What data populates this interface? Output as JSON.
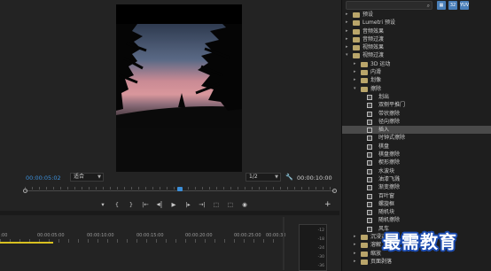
{
  "program_monitor": {
    "timecode_current": "00:00:05:02",
    "fit": "适合",
    "resolution": "1/2",
    "timecode_duration": "00:00:10:00",
    "playhead_progress": 0.5
  },
  "transport": {
    "buttons": [
      "mark-in",
      "mark-out",
      "go-to-in",
      "step-back",
      "play",
      "step-forward",
      "go-to-out",
      "lift",
      "extract",
      "export-frame",
      "compare"
    ],
    "glyphs": [
      "▾",
      "{",
      "}",
      "|←",
      "◂|",
      "▶",
      "|▸",
      "→|",
      "⬚",
      "⬚",
      "◉"
    ]
  },
  "timeline": {
    "ruler_labels": [
      "00:00",
      "00:00:05:00",
      "00:00:10:00",
      "00:00:15:00",
      "00:00:20:00",
      "00:00:25:00",
      "00:00:30"
    ],
    "vu_labels": [
      "-12",
      "-18",
      "-24",
      "-30",
      "-36"
    ]
  },
  "effects_panel": {
    "search_placeholder": "",
    "tree": [
      {
        "label": "预设",
        "level": 0,
        "type": "folder",
        "open": false
      },
      {
        "label": "Lumetri 预设",
        "level": 0,
        "type": "folder",
        "open": false
      },
      {
        "label": "音频效果",
        "level": 0,
        "type": "folder",
        "open": false
      },
      {
        "label": "音频过渡",
        "level": 0,
        "type": "folder",
        "open": false
      },
      {
        "label": "视频效果",
        "level": 0,
        "type": "folder",
        "open": false
      },
      {
        "label": "视频过渡",
        "level": 0,
        "type": "folder",
        "open": true
      },
      {
        "label": "3D 运动",
        "level": 1,
        "type": "folder",
        "open": false
      },
      {
        "label": "内滑",
        "level": 1,
        "type": "folder",
        "open": false
      },
      {
        "label": "划像",
        "level": 1,
        "type": "folder",
        "open": false
      },
      {
        "label": "擦除",
        "level": 1,
        "type": "folder",
        "open": true
      },
      {
        "label": "划出",
        "level": 2,
        "type": "effect"
      },
      {
        "label": "双侧平推门",
        "level": 2,
        "type": "effect"
      },
      {
        "label": "带状擦除",
        "level": 2,
        "type": "effect"
      },
      {
        "label": "径向擦除",
        "level": 2,
        "type": "effect"
      },
      {
        "label": "插入",
        "level": 2,
        "type": "effect",
        "selected": true
      },
      {
        "label": "时钟式擦除",
        "level": 2,
        "type": "effect"
      },
      {
        "label": "棋盘",
        "level": 2,
        "type": "effect"
      },
      {
        "label": "棋盘擦除",
        "level": 2,
        "type": "effect"
      },
      {
        "label": "楔形擦除",
        "level": 2,
        "type": "effect"
      },
      {
        "label": "水波块",
        "level": 2,
        "type": "effect"
      },
      {
        "label": "油漆飞溅",
        "level": 2,
        "type": "effect"
      },
      {
        "label": "渐变擦除",
        "level": 2,
        "type": "effect"
      },
      {
        "label": "百叶窗",
        "level": 2,
        "type": "effect"
      },
      {
        "label": "螺旋框",
        "level": 2,
        "type": "effect"
      },
      {
        "label": "随机块",
        "level": 2,
        "type": "effect"
      },
      {
        "label": "随机擦除",
        "level": 2,
        "type": "effect"
      },
      {
        "label": "风车",
        "level": 2,
        "type": "effect"
      },
      {
        "label": "沉浸式",
        "level": 1,
        "type": "folder",
        "open": false
      },
      {
        "label": "溶解",
        "level": 1,
        "type": "folder",
        "open": false
      },
      {
        "label": "缩放",
        "level": 1,
        "type": "folder",
        "open": false
      },
      {
        "label": "页面剥落",
        "level": 1,
        "type": "folder",
        "open": false
      }
    ]
  },
  "watermark": "最需教育",
  "colors": {
    "accent_blue": "#3b8ed8",
    "folder": "#b9a56a",
    "work_area": "#d8c020"
  }
}
